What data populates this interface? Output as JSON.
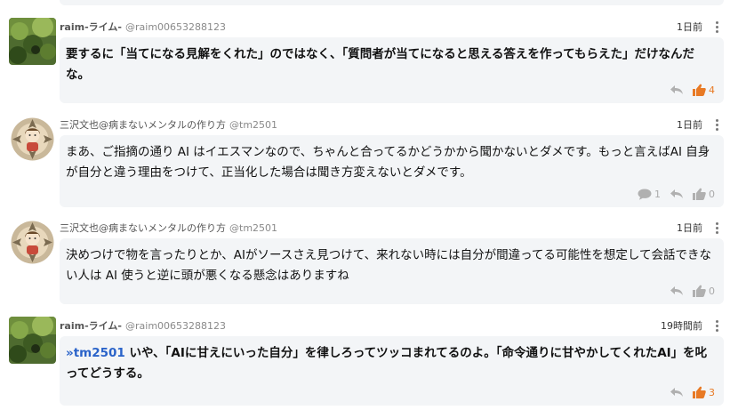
{
  "comments": [
    {
      "author": "raim-ライム-",
      "handle": "@raim00653288123",
      "time": "1日前",
      "mention": "",
      "text": "要するに「当てになる見解をくれた」のではなく、「質問者が当てになると思える答えを作ってもらえた」だけなんだな。",
      "reply_count": "",
      "like_count": "4",
      "liked": true,
      "bold": true
    },
    {
      "author": "三沢文也@病まないメンタルの作り方",
      "handle": "@tm2501",
      "time": "1日前",
      "mention": "",
      "text": "まあ、ご指摘の通り AI はイエスマンなので、ちゃんと合ってるかどうかから聞かないとダメです。もっと言えばAI 自身が自分と違う理由をつけて、正当化した場合は聞き方変えないとダメです。",
      "reply_count": "1",
      "like_count": "0",
      "liked": false,
      "bold": false
    },
    {
      "author": "三沢文也@病まないメンタルの作り方",
      "handle": "@tm2501",
      "time": "1日前",
      "mention": "",
      "text": "決めつけで物を言ったりとか、AIがソースさえ見つけて、来れない時には自分が間違ってる可能性を想定して会話できない人は AI 使うと逆に頭が悪くなる懸念はありますね",
      "reply_count": "",
      "like_count": "0",
      "liked": false,
      "bold": false
    },
    {
      "author": "raim-ライム-",
      "handle": "@raim00653288123",
      "time": "19時間前",
      "mention": "»tm2501",
      "text": " いや、「AIに甘えにいった自分」を律しろってツッコまれてるのよ。「命令通りに甘やかしてくれたAI」を叱ってどうする。",
      "reply_count": "",
      "like_count": "3",
      "liked": true,
      "bold": true
    }
  ],
  "icons": {
    "reply": "reply-arrow-icon",
    "like": "thumbs-up-icon",
    "comment": "speech-bubble-icon",
    "menu": "kebab-menu-icon"
  },
  "colors": {
    "bubble": "#f3f5f7",
    "like_active": "#e87a25",
    "mention": "#2a63c9"
  }
}
